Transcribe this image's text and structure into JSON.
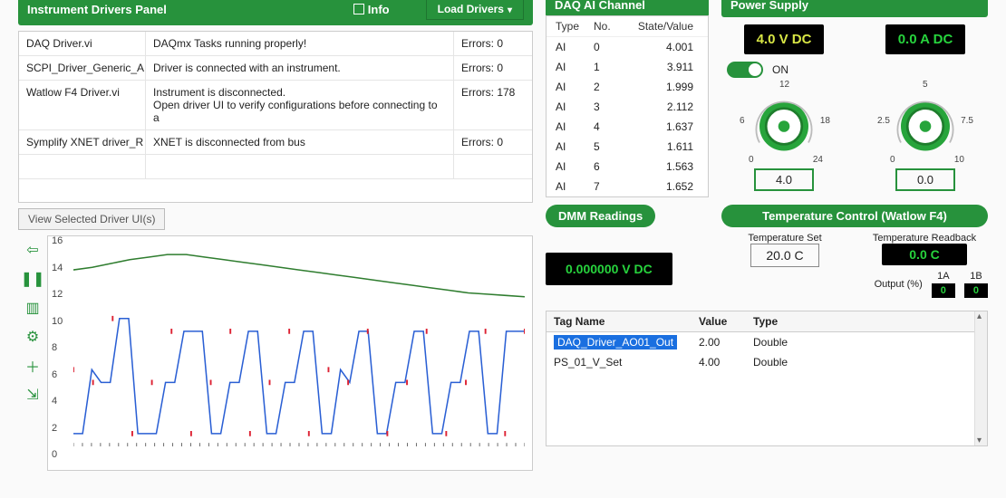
{
  "left_panel": {
    "title": "Instrument Drivers Panel",
    "info_label": "Info",
    "load_btn": "Load Drivers",
    "view_btn": "View Selected Driver UI(s)",
    "drivers": [
      {
        "name": "DAQ Driver.vi",
        "msg": "DAQmx Tasks running properly!",
        "err": "Errors: 0"
      },
      {
        "name": "SCPI_Driver_Generic_A.",
        "msg": "Driver is connected with an instrument.",
        "err": "Errors: 0"
      },
      {
        "name": "Watlow F4 Driver.vi",
        "msg": "Instrument is disconnected.\nOpen driver UI to verify configurations before connecting to a",
        "err": "Errors: 178"
      },
      {
        "name": "Symplify XNET driver_R",
        "msg": "XNET is disconnected from bus",
        "err": "Errors: 0"
      }
    ]
  },
  "daq": {
    "title": "DAQ AI Channel",
    "cols": {
      "type": "Type",
      "no": "No.",
      "state": "State/Value"
    },
    "rows": [
      {
        "type": "AI",
        "no": "0",
        "val": "4.001"
      },
      {
        "type": "AI",
        "no": "1",
        "val": "3.911"
      },
      {
        "type": "AI",
        "no": "2",
        "val": "1.999"
      },
      {
        "type": "AI",
        "no": "3",
        "val": "2.112"
      },
      {
        "type": "AI",
        "no": "4",
        "val": "1.637"
      },
      {
        "type": "AI",
        "no": "5",
        "val": "1.611"
      },
      {
        "type": "AI",
        "no": "6",
        "val": "1.563"
      },
      {
        "type": "AI",
        "no": "7",
        "val": "1.652"
      }
    ]
  },
  "ps": {
    "title": "Power Supply",
    "v_display": "4.0 V DC",
    "a_display": "0.0 A DC",
    "switch_label": "ON",
    "v_set": "4.0",
    "a_set": "0.0",
    "dial1": {
      "tl": "6",
      "tt": "12",
      "tr": "18",
      "bl": "0",
      "br": "24"
    },
    "dial2": {
      "tl": "2.5",
      "tt": "5",
      "tr": "7.5",
      "bl": "0",
      "br": "10"
    }
  },
  "dmm": {
    "title": "DMM Readings",
    "value": "0.000000  V DC"
  },
  "temp": {
    "title": "Temperature Control (Watlow F4)",
    "set_label": "Temperature Set",
    "set_val": "20.0 C",
    "rb_label": "Temperature Readback",
    "rb_val": "0.0 C",
    "out_label": "Output (%)",
    "out_a_label": "1A",
    "out_a": "0",
    "out_b_label": "1B",
    "out_b": "0"
  },
  "tags": {
    "cols": {
      "name": "Tag Name",
      "value": "Value",
      "type": "Type"
    },
    "rows": [
      {
        "name": "DAQ_Driver_AO01_Out",
        "value": "2.00",
        "type": "Double",
        "selected": true
      },
      {
        "name": "PS_01_V_Set",
        "value": "4.00",
        "type": "Double",
        "selected": false
      }
    ]
  },
  "chart_data": {
    "type": "line",
    "ylim": [
      0,
      16
    ],
    "yticks": [
      0,
      2,
      4,
      6,
      8,
      10,
      12,
      14,
      16
    ],
    "x_range": [
      0,
      100
    ],
    "series": [
      {
        "name": "green",
        "color": "#2f7d2f",
        "values": [
          13.8,
          14.0,
          14.3,
          14.6,
          14.8,
          15.0,
          15.0,
          14.8,
          14.6,
          14.4,
          14.2,
          14.0,
          13.8,
          13.6,
          13.4,
          13.2,
          13.0,
          12.8,
          12.6,
          12.4,
          12.2,
          12.0,
          11.9,
          11.8,
          11.7
        ]
      },
      {
        "name": "blue",
        "color": "#2a5fd4",
        "values": [
          1,
          1,
          6,
          5,
          5,
          10,
          10,
          1,
          1,
          1,
          5,
          5,
          9,
          9,
          9,
          1,
          1,
          5,
          5,
          9,
          9,
          1,
          1,
          5,
          5,
          9,
          9,
          1,
          1,
          6,
          5,
          9,
          9,
          1,
          1,
          5,
          5,
          9,
          9,
          1,
          1,
          5,
          5,
          9,
          9,
          1,
          1,
          9,
          9,
          9
        ]
      }
    ],
    "markers": {
      "color": "#d23",
      "values": [
        6,
        5,
        10,
        1,
        5,
        9,
        1,
        5,
        9,
        1,
        5,
        9,
        1,
        6,
        5,
        9,
        1,
        5,
        9,
        1,
        5,
        9,
        1,
        9
      ]
    }
  }
}
